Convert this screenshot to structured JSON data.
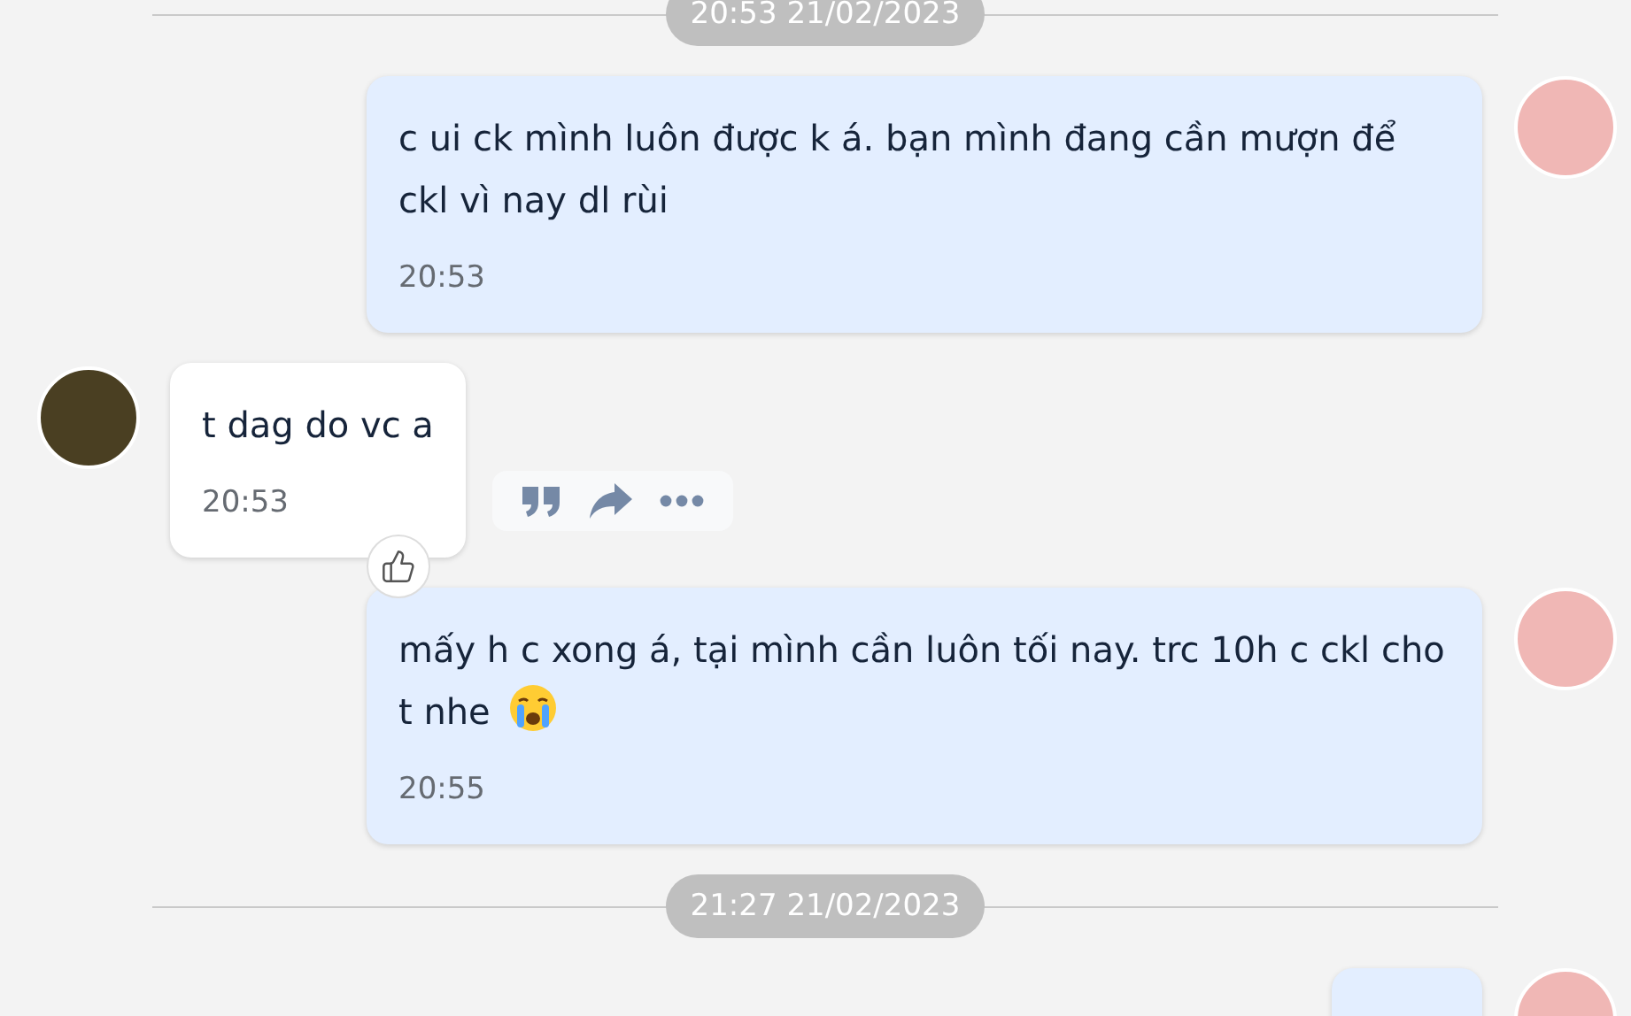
{
  "messages": [
    {
      "kind": "divider",
      "label": "20:53 21/02/2023"
    },
    {
      "kind": "outgoing",
      "text": "c ui ck mình luôn được k á. bạn mình đang cần mượn để ckl vì nay dl rùi",
      "time": "20:53"
    },
    {
      "kind": "incoming",
      "text": "t dag do vc a",
      "time": "20:53",
      "liked": true,
      "actions": true
    },
    {
      "kind": "outgoing",
      "text": "mấy h c xong á, tại mình cần luôn tối nay. trc 10h c ckl cho t nhe",
      "time": "20:55",
      "crying_emoji": true
    },
    {
      "kind": "divider",
      "label": "21:27 21/02/2023"
    },
    {
      "kind": "outgoing"
    }
  ]
}
